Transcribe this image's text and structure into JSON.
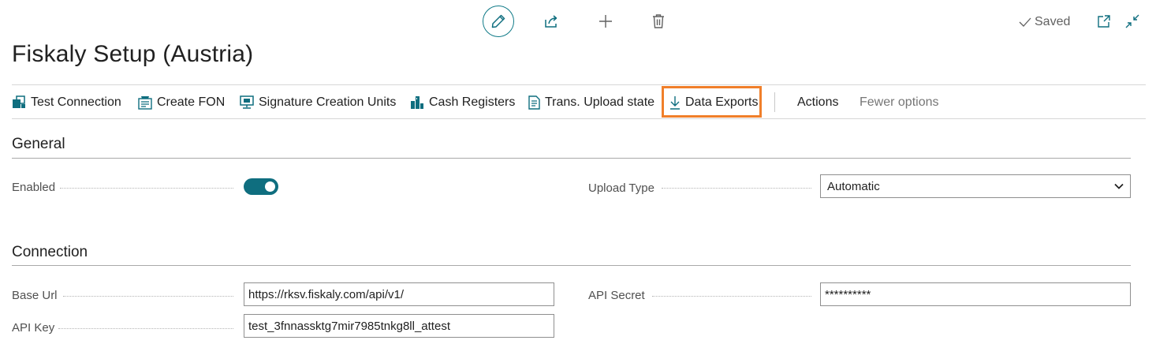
{
  "header": {
    "saved_label": "Saved",
    "icons": [
      "edit-icon",
      "share-icon",
      "add-icon",
      "delete-icon",
      "open-new-window-icon",
      "collapse-icon"
    ]
  },
  "page": {
    "title": "Fiskaly Setup (Austria)"
  },
  "actions": {
    "test_connection": "Test Connection",
    "create_fon": "Create FON",
    "signature_units": "Signature Creation Units",
    "cash_registers": "Cash Registers",
    "upload_state": "Trans. Upload state",
    "data_exports": "Data Exports",
    "more": "Actions",
    "fewer": "Fewer options"
  },
  "general": {
    "title": "General",
    "enabled_label": "Enabled",
    "enabled": true,
    "upload_type_label": "Upload Type",
    "upload_type_value": "Automatic"
  },
  "connection": {
    "title": "Connection",
    "base_url_label": "Base Url",
    "base_url_value": "https://rksv.fiskaly.com/api/v1/",
    "api_key_label": "API Key",
    "api_key_value": "test_3fnnassktg7mir7985tnkg8ll_attest",
    "api_secret_label": "API Secret",
    "api_secret_value": "**********"
  },
  "colors": {
    "accent": "#0f6e7f",
    "highlight": "#f07f2a"
  }
}
